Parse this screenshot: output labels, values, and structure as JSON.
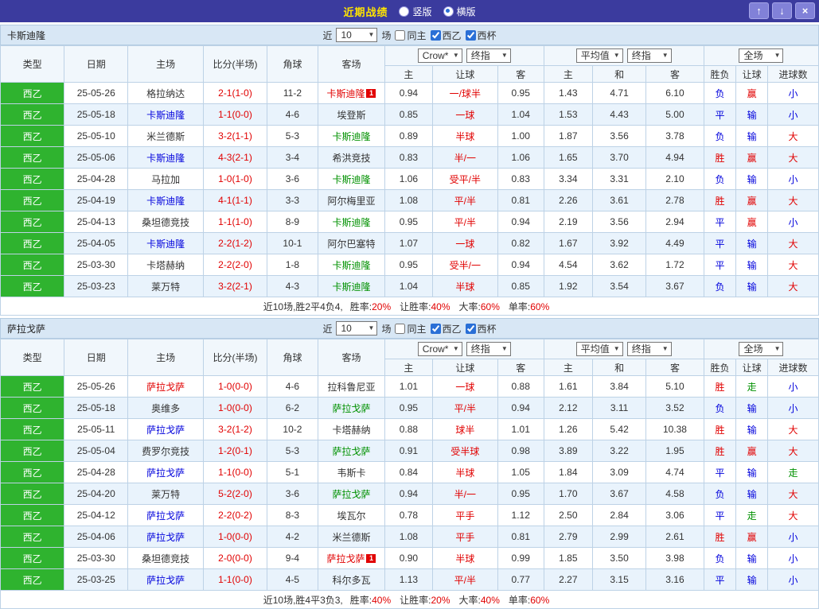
{
  "titlebar": {
    "title": "近期战绩",
    "radios": [
      {
        "label": "竖版",
        "selected": false
      },
      {
        "label": "横版",
        "selected": true
      }
    ],
    "buttons": {
      "up": "↑",
      "down": "↓",
      "close": "×"
    }
  },
  "filter": {
    "near_label": "近",
    "count_value": "10",
    "matches_label": "场",
    "checkboxes": [
      {
        "label": "同主",
        "checked": false
      },
      {
        "label": "西乙",
        "checked": true
      },
      {
        "label": "西杯",
        "checked": true
      }
    ]
  },
  "columns": {
    "type": "类型",
    "date": "日期",
    "home": "主场",
    "score": "比分(半场)",
    "corner": "角球",
    "away": "客场",
    "odds_home": "主",
    "handicap": "让球",
    "odds_away": "客",
    "avg_home": "主",
    "avg_draw": "和",
    "avg_away": "客",
    "wdl": "胜负",
    "hcp_result": "让球",
    "goals": "进球数"
  },
  "header_selects": {
    "bookmaker": "Crow*",
    "final1": "终指",
    "average": "平均值",
    "final2": "终指",
    "fulltime": "全场"
  },
  "colors": {
    "titlebar_bg": "#3b3b9e",
    "title_text": "#ffe400",
    "league_green": "#2fb32f",
    "win_red": "#e10000",
    "draw_blue": "#0000dc",
    "walk_green": "#009100",
    "row_alt_bg": "#e9f3fc",
    "section_bar_bg": "#d8e7f5"
  },
  "sections": [
    {
      "team": "卡斯迪隆",
      "rows": [
        {
          "type": "西乙",
          "date": "25-05-26",
          "home": "格拉纳达",
          "home_color": "black",
          "score": "2-1(1-0)",
          "corner": "11-2",
          "away": "卡斯迪隆",
          "away_color": "red",
          "away_badge": "1",
          "odds_home": "0.94",
          "handicap": "一/球半",
          "odds_away": "0.95",
          "avg_home": "1.43",
          "avg_draw": "4.71",
          "avg_away": "6.10",
          "wdl": "负",
          "wdl_color": "blue",
          "hcp_result": "赢",
          "hcp_result_color": "red",
          "goals": "小",
          "goals_color": "blue"
        },
        {
          "type": "西乙",
          "date": "25-05-18",
          "home": "卡斯迪隆",
          "home_color": "blue",
          "score": "1-1(0-0)",
          "corner": "4-6",
          "away": "埃登斯",
          "away_color": "black",
          "odds_home": "0.85",
          "handicap": "一球",
          "odds_away": "1.04",
          "avg_home": "1.53",
          "avg_draw": "4.43",
          "avg_away": "5.00",
          "wdl": "平",
          "wdl_color": "blue",
          "hcp_result": "输",
          "hcp_result_color": "blue",
          "goals": "小",
          "goals_color": "blue"
        },
        {
          "type": "西乙",
          "date": "25-05-10",
          "home": "米兰德斯",
          "home_color": "black",
          "score": "3-2(1-1)",
          "corner": "5-3",
          "away": "卡斯迪隆",
          "away_color": "green",
          "odds_home": "0.89",
          "handicap": "半球",
          "odds_away": "1.00",
          "avg_home": "1.87",
          "avg_draw": "3.56",
          "avg_away": "3.78",
          "wdl": "负",
          "wdl_color": "blue",
          "hcp_result": "输",
          "hcp_result_color": "blue",
          "goals": "大",
          "goals_color": "red"
        },
        {
          "type": "西乙",
          "date": "25-05-06",
          "home": "卡斯迪隆",
          "home_color": "blue",
          "score": "4-3(2-1)",
          "corner": "3-4",
          "away": "希洪竞技",
          "away_color": "black",
          "odds_home": "0.83",
          "handicap": "半/一",
          "odds_away": "1.06",
          "avg_home": "1.65",
          "avg_draw": "3.70",
          "avg_away": "4.94",
          "wdl": "胜",
          "wdl_color": "red",
          "hcp_result": "赢",
          "hcp_result_color": "red",
          "goals": "大",
          "goals_color": "red"
        },
        {
          "type": "西乙",
          "date": "25-04-28",
          "home": "马拉加",
          "home_color": "black",
          "score": "1-0(1-0)",
          "corner": "3-6",
          "away": "卡斯迪隆",
          "away_color": "green",
          "odds_home": "1.06",
          "handicap": "受平/半",
          "odds_away": "0.83",
          "avg_home": "3.34",
          "avg_draw": "3.31",
          "avg_away": "2.10",
          "wdl": "负",
          "wdl_color": "blue",
          "hcp_result": "输",
          "hcp_result_color": "blue",
          "goals": "小",
          "goals_color": "blue"
        },
        {
          "type": "西乙",
          "date": "25-04-19",
          "home": "卡斯迪隆",
          "home_color": "blue",
          "score": "4-1(1-1)",
          "corner": "3-3",
          "away": "阿尔梅里亚",
          "away_color": "black",
          "odds_home": "1.08",
          "handicap": "平/半",
          "odds_away": "0.81",
          "avg_home": "2.26",
          "avg_draw": "3.61",
          "avg_away": "2.78",
          "wdl": "胜",
          "wdl_color": "red",
          "hcp_result": "赢",
          "hcp_result_color": "red",
          "goals": "大",
          "goals_color": "red"
        },
        {
          "type": "西乙",
          "date": "25-04-13",
          "home": "桑坦德竞技",
          "home_color": "black",
          "score": "1-1(1-0)",
          "corner": "8-9",
          "away": "卡斯迪隆",
          "away_color": "green",
          "odds_home": "0.95",
          "handicap": "平/半",
          "odds_away": "0.94",
          "avg_home": "2.19",
          "avg_draw": "3.56",
          "avg_away": "2.94",
          "wdl": "平",
          "wdl_color": "blue",
          "hcp_result": "赢",
          "hcp_result_color": "red",
          "goals": "小",
          "goals_color": "blue"
        },
        {
          "type": "西乙",
          "date": "25-04-05",
          "home": "卡斯迪隆",
          "home_color": "blue",
          "score": "2-2(1-2)",
          "corner": "10-1",
          "away": "阿尔巴塞特",
          "away_color": "black",
          "odds_home": "1.07",
          "handicap": "一球",
          "odds_away": "0.82",
          "avg_home": "1.67",
          "avg_draw": "3.92",
          "avg_away": "4.49",
          "wdl": "平",
          "wdl_color": "blue",
          "hcp_result": "输",
          "hcp_result_color": "blue",
          "goals": "大",
          "goals_color": "red"
        },
        {
          "type": "西乙",
          "date": "25-03-30",
          "home": "卡塔赫纳",
          "home_color": "black",
          "score": "2-2(2-0)",
          "corner": "1-8",
          "away": "卡斯迪隆",
          "away_color": "green",
          "odds_home": "0.95",
          "handicap": "受半/一",
          "odds_away": "0.94",
          "avg_home": "4.54",
          "avg_draw": "3.62",
          "avg_away": "1.72",
          "wdl": "平",
          "wdl_color": "blue",
          "hcp_result": "输",
          "hcp_result_color": "blue",
          "goals": "大",
          "goals_color": "red"
        },
        {
          "type": "西乙",
          "date": "25-03-23",
          "home": "莱万特",
          "home_color": "black",
          "score": "3-2(2-1)",
          "corner": "4-3",
          "away": "卡斯迪隆",
          "away_color": "green",
          "odds_home": "1.04",
          "handicap": "半球",
          "odds_away": "0.85",
          "avg_home": "1.92",
          "avg_draw": "3.54",
          "avg_away": "3.67",
          "wdl": "负",
          "wdl_color": "blue",
          "hcp_result": "输",
          "hcp_result_color": "blue",
          "goals": "大",
          "goals_color": "red"
        }
      ],
      "summary": {
        "prefix": "近10场,胜2平4负4,",
        "stats": [
          {
            "label": "胜率:",
            "value": "20%"
          },
          {
            "label": "让胜率:",
            "value": "40%"
          },
          {
            "label": "大率:",
            "value": "60%"
          },
          {
            "label": "单率:",
            "value": "60%"
          }
        ]
      }
    },
    {
      "team": "萨拉戈萨",
      "rows": [
        {
          "type": "西乙",
          "date": "25-05-26",
          "home": "萨拉戈萨",
          "home_color": "red",
          "score": "1-0(0-0)",
          "corner": "4-6",
          "away": "拉科鲁尼亚",
          "away_color": "black",
          "odds_home": "1.01",
          "handicap": "一球",
          "odds_away": "0.88",
          "avg_home": "1.61",
          "avg_draw": "3.84",
          "avg_away": "5.10",
          "wdl": "胜",
          "wdl_color": "red",
          "hcp_result": "走",
          "hcp_result_color": "green",
          "goals": "小",
          "goals_color": "blue"
        },
        {
          "type": "西乙",
          "date": "25-05-18",
          "home": "奥维多",
          "home_color": "black",
          "score": "1-0(0-0)",
          "corner": "6-2",
          "away": "萨拉戈萨",
          "away_color": "green",
          "odds_home": "0.95",
          "handicap": "平/半",
          "odds_away": "0.94",
          "avg_home": "2.12",
          "avg_draw": "3.11",
          "avg_away": "3.52",
          "wdl": "负",
          "wdl_color": "blue",
          "hcp_result": "输",
          "hcp_result_color": "blue",
          "goals": "小",
          "goals_color": "blue"
        },
        {
          "type": "西乙",
          "date": "25-05-11",
          "home": "萨拉戈萨",
          "home_color": "blue",
          "score": "3-2(1-2)",
          "corner": "10-2",
          "away": "卡塔赫纳",
          "away_color": "black",
          "odds_home": "0.88",
          "handicap": "球半",
          "odds_away": "1.01",
          "avg_home": "1.26",
          "avg_draw": "5.42",
          "avg_away": "10.38",
          "wdl": "胜",
          "wdl_color": "red",
          "hcp_result": "输",
          "hcp_result_color": "blue",
          "goals": "大",
          "goals_color": "red"
        },
        {
          "type": "西乙",
          "date": "25-05-04",
          "home": "费罗尔竞技",
          "home_color": "black",
          "score": "1-2(0-1)",
          "corner": "5-3",
          "away": "萨拉戈萨",
          "away_color": "green",
          "odds_home": "0.91",
          "handicap": "受半球",
          "odds_away": "0.98",
          "avg_home": "3.89",
          "avg_draw": "3.22",
          "avg_away": "1.95",
          "wdl": "胜",
          "wdl_color": "red",
          "hcp_result": "赢",
          "hcp_result_color": "red",
          "goals": "大",
          "goals_color": "red"
        },
        {
          "type": "西乙",
          "date": "25-04-28",
          "home": "萨拉戈萨",
          "home_color": "blue",
          "score": "1-1(0-0)",
          "corner": "5-1",
          "away": "韦斯卡",
          "away_color": "black",
          "odds_home": "0.84",
          "handicap": "半球",
          "odds_away": "1.05",
          "avg_home": "1.84",
          "avg_draw": "3.09",
          "avg_away": "4.74",
          "wdl": "平",
          "wdl_color": "blue",
          "hcp_result": "输",
          "hcp_result_color": "blue",
          "goals": "走",
          "goals_color": "green"
        },
        {
          "type": "西乙",
          "date": "25-04-20",
          "home": "莱万特",
          "home_color": "black",
          "score": "5-2(2-0)",
          "corner": "3-6",
          "away": "萨拉戈萨",
          "away_color": "green",
          "odds_home": "0.94",
          "handicap": "半/一",
          "odds_away": "0.95",
          "avg_home": "1.70",
          "avg_draw": "3.67",
          "avg_away": "4.58",
          "wdl": "负",
          "wdl_color": "blue",
          "hcp_result": "输",
          "hcp_result_color": "blue",
          "goals": "大",
          "goals_color": "red"
        },
        {
          "type": "西乙",
          "date": "25-04-12",
          "home": "萨拉戈萨",
          "home_color": "blue",
          "score": "2-2(0-2)",
          "corner": "8-3",
          "away": "埃瓦尔",
          "away_color": "black",
          "odds_home": "0.78",
          "handicap": "平手",
          "odds_away": "1.12",
          "avg_home": "2.50",
          "avg_draw": "2.84",
          "avg_away": "3.06",
          "wdl": "平",
          "wdl_color": "blue",
          "hcp_result": "走",
          "hcp_result_color": "green",
          "goals": "大",
          "goals_color": "red"
        },
        {
          "type": "西乙",
          "date": "25-04-06",
          "home": "萨拉戈萨",
          "home_color": "blue",
          "score": "1-0(0-0)",
          "corner": "4-2",
          "away": "米兰德斯",
          "away_color": "black",
          "odds_home": "1.08",
          "handicap": "平手",
          "odds_away": "0.81",
          "avg_home": "2.79",
          "avg_draw": "2.99",
          "avg_away": "2.61",
          "wdl": "胜",
          "wdl_color": "red",
          "hcp_result": "赢",
          "hcp_result_color": "red",
          "goals": "小",
          "goals_color": "blue"
        },
        {
          "type": "西乙",
          "date": "25-03-30",
          "home": "桑坦德竞技",
          "home_color": "black",
          "score": "2-0(0-0)",
          "corner": "9-4",
          "away": "萨拉戈萨",
          "away_color": "red",
          "away_badge": "1",
          "odds_home": "0.90",
          "handicap": "半球",
          "odds_away": "0.99",
          "avg_home": "1.85",
          "avg_draw": "3.50",
          "avg_away": "3.98",
          "wdl": "负",
          "wdl_color": "blue",
          "hcp_result": "输",
          "hcp_result_color": "blue",
          "goals": "小",
          "goals_color": "blue"
        },
        {
          "type": "西乙",
          "date": "25-03-25",
          "home": "萨拉戈萨",
          "home_color": "blue",
          "score": "1-1(0-0)",
          "corner": "4-5",
          "away": "科尔多瓦",
          "away_color": "black",
          "odds_home": "1.13",
          "handicap": "平/半",
          "odds_away": "0.77",
          "avg_home": "2.27",
          "avg_draw": "3.15",
          "avg_away": "3.16",
          "wdl": "平",
          "wdl_color": "blue",
          "hcp_result": "输",
          "hcp_result_color": "blue",
          "goals": "小",
          "goals_color": "blue"
        }
      ],
      "summary": {
        "prefix": "近10场,胜4平3负3,",
        "stats": [
          {
            "label": "胜率:",
            "value": "40%"
          },
          {
            "label": "让胜率:",
            "value": "20%"
          },
          {
            "label": "大率:",
            "value": "40%"
          },
          {
            "label": "单率:",
            "value": "60%"
          }
        ]
      }
    }
  ]
}
